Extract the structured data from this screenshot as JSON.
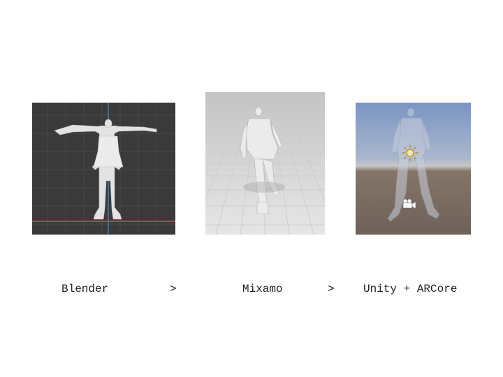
{
  "pipeline": {
    "steps": [
      {
        "label": "Blender"
      },
      {
        "label": "Mixamo"
      },
      {
        "label": "Unity + ARCore"
      }
    ],
    "separators": [
      ">",
      ">"
    ]
  },
  "colors": {
    "blender_bg": "#3a3a3a",
    "blender_grid": "#4a4a4a",
    "axis_blue": "#4b79b6",
    "axis_red": "#b85a5a",
    "mixamo_bg": "#dcdcdc",
    "unity_sky": "#8a9fc0",
    "unity_ground": "#7a6a60",
    "model": "#e6e6e6"
  },
  "icons": [
    "sun-light-icon",
    "camera-icon"
  ]
}
